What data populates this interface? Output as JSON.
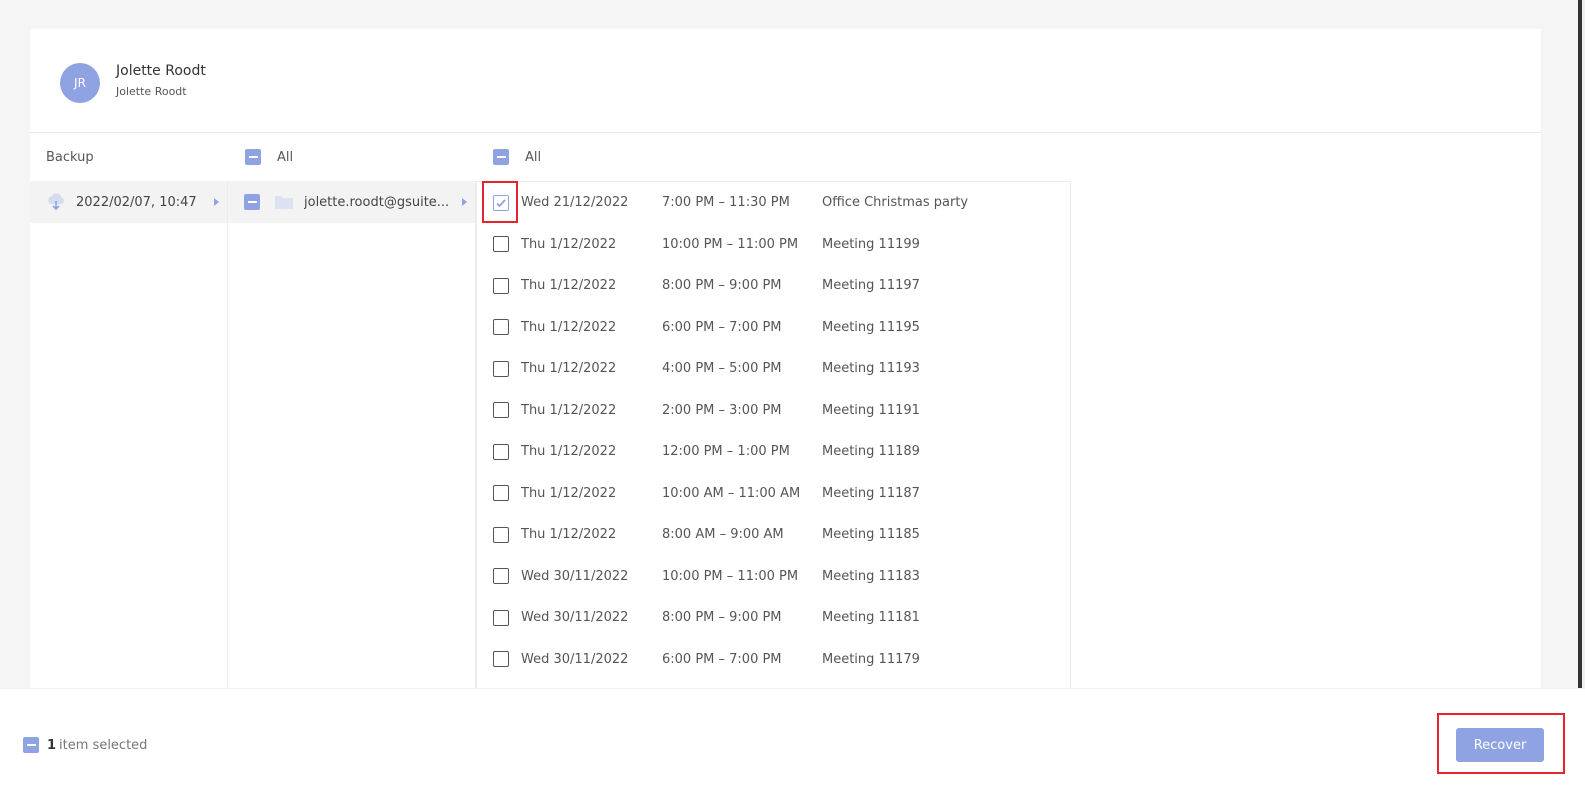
{
  "user": {
    "initials": "JR",
    "name": "Jolette Roodt",
    "subtitle": "Jolette Roodt"
  },
  "columns": {
    "backup_header": "Backup",
    "folders_header": "All",
    "items_header": "All"
  },
  "backup": {
    "label": "2022/02/07, 10:47"
  },
  "folder": {
    "label": "jolette.roodt@gsuite..."
  },
  "items": [
    {
      "date": "Wed 21/12/2022",
      "time": "7:00 PM – 11:30 PM",
      "title": "Office Christmas party",
      "checked": true
    },
    {
      "date": "Thu 1/12/2022",
      "time": "10:00 PM – 11:00 PM",
      "title": "Meeting 11199",
      "checked": false
    },
    {
      "date": "Thu 1/12/2022",
      "time": "8:00 PM – 9:00 PM",
      "title": "Meeting 11197",
      "checked": false
    },
    {
      "date": "Thu 1/12/2022",
      "time": "6:00 PM – 7:00 PM",
      "title": "Meeting 11195",
      "checked": false
    },
    {
      "date": "Thu 1/12/2022",
      "time": "4:00 PM – 5:00 PM",
      "title": "Meeting 11193",
      "checked": false
    },
    {
      "date": "Thu 1/12/2022",
      "time": "2:00 PM – 3:00 PM",
      "title": "Meeting 11191",
      "checked": false
    },
    {
      "date": "Thu 1/12/2022",
      "time": "12:00 PM – 1:00 PM",
      "title": "Meeting 11189",
      "checked": false
    },
    {
      "date": "Thu 1/12/2022",
      "time": "10:00 AM – 11:00 AM",
      "title": "Meeting 11187",
      "checked": false
    },
    {
      "date": "Thu 1/12/2022",
      "time": "8:00 AM – 9:00 AM",
      "title": "Meeting 11185",
      "checked": false
    },
    {
      "date": "Wed 30/11/2022",
      "time": "10:00 PM – 11:00 PM",
      "title": "Meeting 11183",
      "checked": false
    },
    {
      "date": "Wed 30/11/2022",
      "time": "8:00 PM – 9:00 PM",
      "title": "Meeting 11181",
      "checked": false
    },
    {
      "date": "Wed 30/11/2022",
      "time": "6:00 PM – 7:00 PM",
      "title": "Meeting 11179",
      "checked": false
    }
  ],
  "footer": {
    "count": "1",
    "selected_text": "item selected",
    "recover_label": "Recover"
  },
  "colors": {
    "accent": "#8fa3e3",
    "highlight": "#e3262e"
  }
}
